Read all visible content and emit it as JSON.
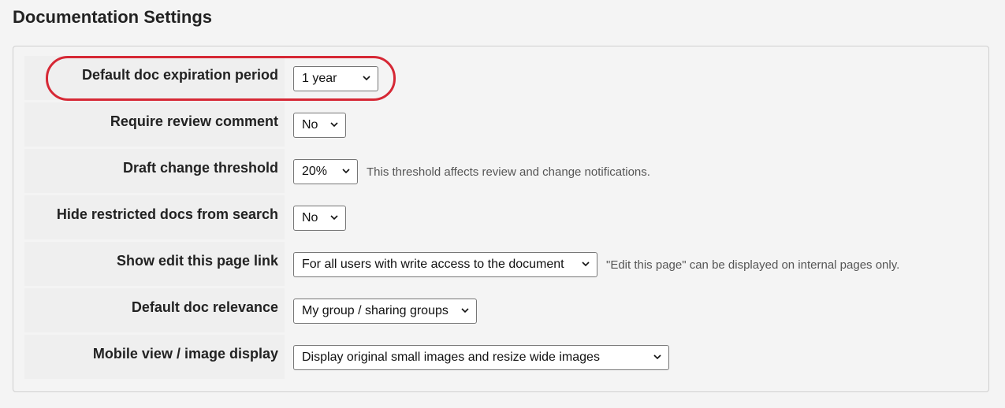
{
  "page": {
    "title": "Documentation Settings",
    "accent_color": "#d62835"
  },
  "settings": [
    {
      "label": "Default doc expiration period",
      "selected": "1 year",
      "note": ""
    },
    {
      "label": "Require review comment",
      "selected": "No",
      "note": ""
    },
    {
      "label": "Draft change threshold",
      "selected": "20%",
      "note": "This threshold affects review and change notifications."
    },
    {
      "label": "Hide restricted docs from search",
      "selected": "No",
      "note": ""
    },
    {
      "label": "Show edit this page link",
      "selected": "For all users with write access to the document",
      "note": "\"Edit this page\" can be displayed on internal pages only."
    },
    {
      "label": "Default doc relevance",
      "selected": "My group / sharing groups",
      "note": ""
    },
    {
      "label": "Mobile view / image display",
      "selected": "Display original small images and resize wide images",
      "note": ""
    }
  ],
  "icons": {
    "dropdown": "chevron-down-icon"
  }
}
